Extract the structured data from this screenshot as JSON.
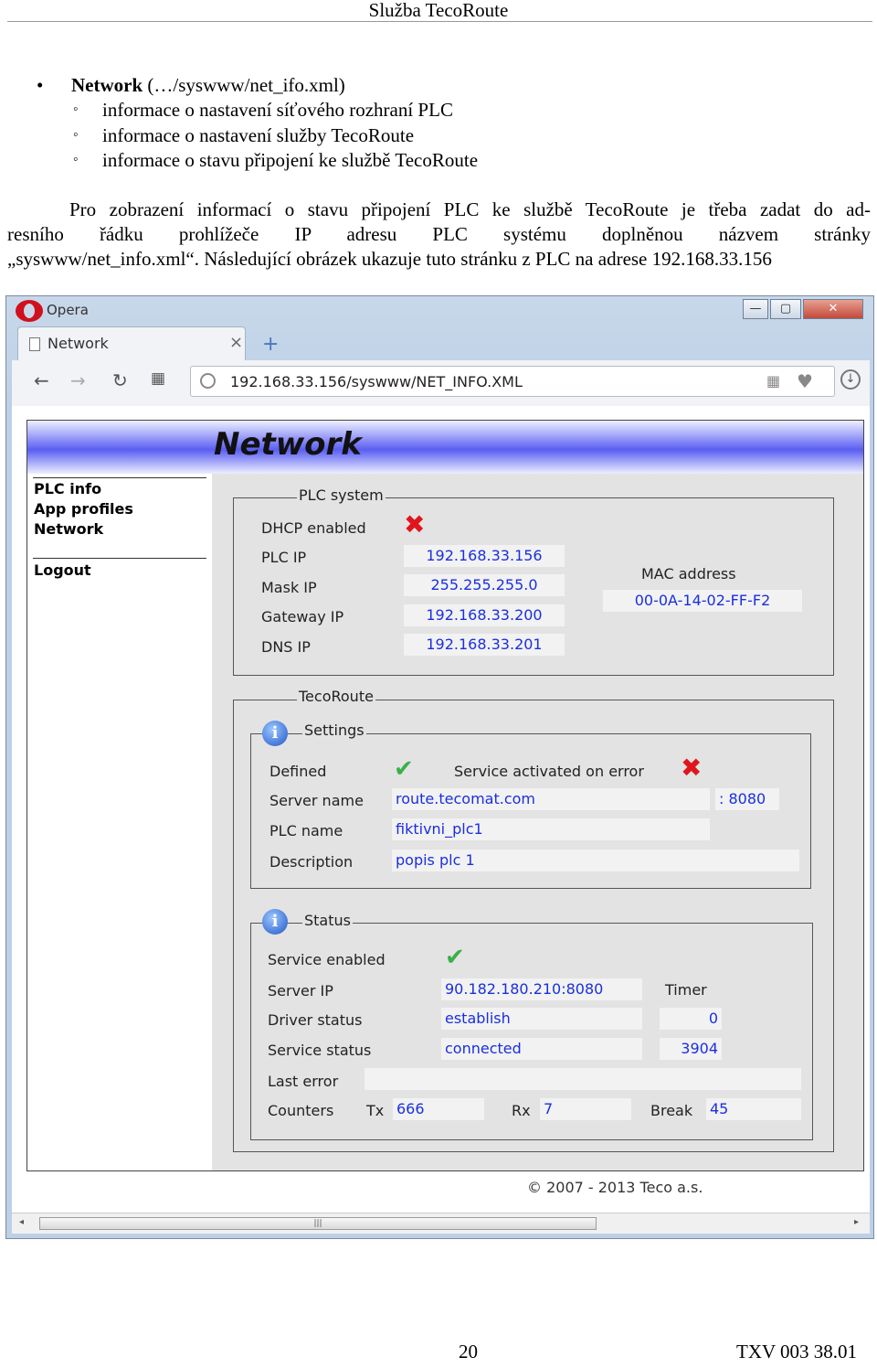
{
  "header": {
    "title": "Služba TecoRoute"
  },
  "bullets": {
    "main_bold": "Network",
    "main_rest": " (…/syswww/net_ifo.xml)",
    "sub": [
      "informace o nastavení síťového rozhraní PLC",
      "informace o nastavení služby TecoRoute",
      "informace o stavu připojení ke službě TecoRoute"
    ]
  },
  "paragraph": {
    "line1": "Pro zobrazení informací o stavu připojení PLC ke službě TecoRoute je třeba zadat do ad-",
    "line2": "resního řádku prohlížeče IP adresu PLC systému doplněnou názvem stránky",
    "line3": "„syswww/net_info.xml“. Následující obrázek ukazuje tuto stránku z PLC na adrese 192.168.33.156"
  },
  "browser": {
    "app_name": "Opera",
    "tab_title": "Network",
    "url": "192.168.33.156/syswww/NET_INFO.XML",
    "win_buttons": [
      "—",
      "▢",
      "✕"
    ]
  },
  "webpage": {
    "title": "Network",
    "menu": [
      "PLC info",
      "App profiles",
      "Network"
    ],
    "logout": "Logout",
    "plc_system": {
      "legend": "PLC system",
      "dhcp_label": "DHCP enabled",
      "plc_ip_label": "PLC IP",
      "plc_ip": "192.168.33.156",
      "mask_label": "Mask IP",
      "mask": "255.255.255.0",
      "gateway_label": "Gateway IP",
      "gateway": "192.168.33.200",
      "dns_label": "DNS IP",
      "dns": "192.168.33.201",
      "mac_label": "MAC address",
      "mac": "00-0A-14-02-FF-F2"
    },
    "tecoroute": {
      "legend": "TecoRoute",
      "settings": {
        "legend": "Settings",
        "defined_label": "Defined",
        "activated_label": "Service activated on error",
        "server_label": "Server name",
        "server": "route.tecomat.com",
        "port": ": 8080",
        "plc_name_label": "PLC name",
        "plc_name": "fiktivni_plc1",
        "desc_label": "Description",
        "desc": "popis plc 1"
      },
      "status": {
        "legend": "Status",
        "enabled_label": "Service enabled",
        "server_ip_label": "Server IP",
        "server_ip": "90.182.180.210:8080",
        "timer_label": "Timer",
        "driver_label": "Driver status",
        "driver": "establish",
        "timer1": "0",
        "service_label": "Service status",
        "service": "connected",
        "timer2": "3904",
        "last_error_label": "Last error",
        "last_error": "",
        "counters_label": "Counters",
        "tx_label": "Tx",
        "tx": "666",
        "rx_label": "Rx",
        "rx": "7",
        "break_label": "Break",
        "break": "45"
      }
    },
    "footer": "© 2007 - 2013 Teco a.s."
  },
  "page_footer": {
    "page_number": "20",
    "doc_id": "TXV 003 38.01"
  }
}
